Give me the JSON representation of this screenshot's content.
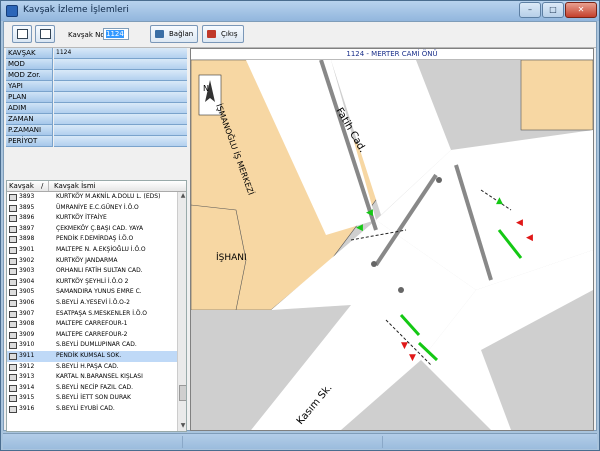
{
  "window": {
    "title": "Kavşak İzleme İşlemleri",
    "min_label": "–",
    "max_label": "□",
    "close_label": "✕"
  },
  "toolbar": {
    "kavsak_no_label": "Kavşak No",
    "kavsak_no_value": "1124",
    "connect_label": "Bağlan",
    "exit_label": "Çıkış"
  },
  "props": [
    {
      "key": "KAVŞAK",
      "value": "1124"
    },
    {
      "key": "MOD",
      "value": ""
    },
    {
      "key": "MOD Zor.",
      "value": ""
    },
    {
      "key": "YAPI",
      "value": ""
    },
    {
      "key": "PLAN",
      "value": ""
    },
    {
      "key": "ADIM",
      "value": ""
    },
    {
      "key": "ZAMAN",
      "value": ""
    },
    {
      "key": "P.ZAMANI",
      "value": ""
    },
    {
      "key": "PERİYOT",
      "value": ""
    }
  ],
  "list": {
    "col1": "Kavşak",
    "col2": "Kavşak İsmi",
    "sort_glyph": "/",
    "rows": [
      {
        "no": "3893",
        "name": "KURTKÖY M.AKNİL A.DOLU L. (EDS)"
      },
      {
        "no": "3895",
        "name": "ÜMRANİYE E.C.GÜNEY İ.Ö.O"
      },
      {
        "no": "3896",
        "name": "KURTKÖY İTFAİYE"
      },
      {
        "no": "3897",
        "name": "ÇEKMEKÖY Ç.BAŞI CAD. YAYA"
      },
      {
        "no": "3898",
        "name": "PENDİK F.DEMİRDAŞ İ.Ö.O"
      },
      {
        "no": "3901",
        "name": "MALTEPE N. A.EKŞİOĞLU İ.Ö.O"
      },
      {
        "no": "3902",
        "name": "KURTKÖY JANDARMA"
      },
      {
        "no": "3903",
        "name": "ORHANLI FATİH SULTAN CAD."
      },
      {
        "no": "3904",
        "name": "KURTKÖY ŞEYHLİ İ.Ö.O 2"
      },
      {
        "no": "3905",
        "name": "SAMANDIRA YUNUS EMRE C."
      },
      {
        "no": "3906",
        "name": "S.BEYLİ A.YESEVİ İ.Ö.O-2"
      },
      {
        "no": "3907",
        "name": "ESATPAŞA S.MESKENLER İ.Ö.O"
      },
      {
        "no": "3908",
        "name": "MALTEPE CARREFOUR-1"
      },
      {
        "no": "3909",
        "name": "MALTEPE CARREFOUR-2"
      },
      {
        "no": "3910",
        "name": "S.BEYLİ DUMLUPINAR CAD."
      },
      {
        "no": "3911",
        "name": "PENDİK KUMSAL SOK."
      },
      {
        "no": "3912",
        "name": "S.BEYLİ H.PAŞA CAD."
      },
      {
        "no": "3913",
        "name": "KARTAL N.BARANSEL KIŞLASI"
      },
      {
        "no": "3914",
        "name": "S.BEYLİ NECİP FAZIL CAD."
      },
      {
        "no": "3915",
        "name": "S.BEYLİ İETT SON DURAK"
      },
      {
        "no": "3916",
        "name": "S.BEYLİ EYUBİ CAD."
      }
    ],
    "selected_index": 15
  },
  "map": {
    "title": "1124 - MERTER CAMİ ÖNÜ",
    "labels": {
      "fatih": "Fatih Cad.",
      "ismanoglu": "İŞMANOĞLU İŞ MERKEZİ",
      "ishani": "İŞHANI",
      "kasim": "Kasım Sk.",
      "north": "N"
    }
  },
  "colors": {
    "building": "#f7d7a3",
    "green": "#14c814",
    "red": "#e01818",
    "road": "#ffffff",
    "block": "#cfcfcf"
  }
}
